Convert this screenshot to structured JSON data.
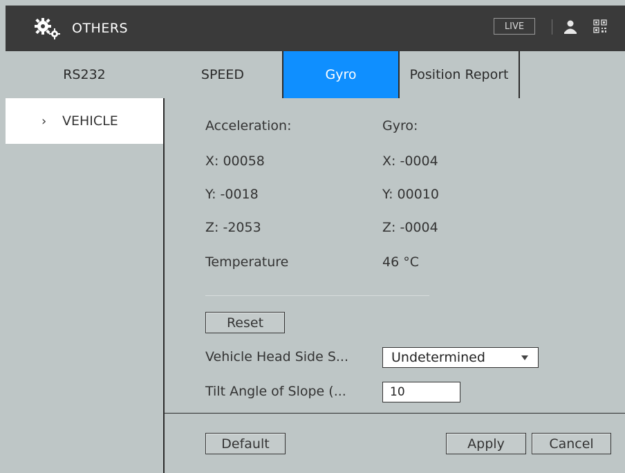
{
  "header": {
    "title": "OTHERS",
    "live_label": "LIVE",
    "icons": [
      "gears-icon",
      "user-icon",
      "qr-code-icon"
    ]
  },
  "tabs": [
    {
      "label": "RS232",
      "active": false
    },
    {
      "label": "SPEED",
      "active": false
    },
    {
      "label": "Gyro",
      "active": true
    },
    {
      "label": "Position Report",
      "active": false
    }
  ],
  "sidebar": {
    "items": [
      {
        "label": "VEHICLE",
        "selected": true
      }
    ]
  },
  "main": {
    "acceleration_label": "Acceleration:",
    "gyro_label": "Gyro:",
    "accel_x": "X: 00058",
    "accel_y": "Y: -0018",
    "accel_z": "Z: -2053",
    "gyro_x": "X: -0004",
    "gyro_y": "Y: 00010",
    "gyro_z": "Z: -0004",
    "temperature_label": "Temperature",
    "temperature_value": "46 °C",
    "reset_label": "Reset",
    "head_side_label": "Vehicle Head Side S...",
    "head_side_value": "Undetermined",
    "tilt_label": "Tilt Angle of Slope (...",
    "tilt_value": "10"
  },
  "footer": {
    "default_label": "Default",
    "apply_label": "Apply",
    "cancel_label": "Cancel"
  },
  "colors": {
    "header_bg": "#3a3a3a",
    "panel_bg": "#bec6c6",
    "active_tab": "#0f8fff"
  }
}
